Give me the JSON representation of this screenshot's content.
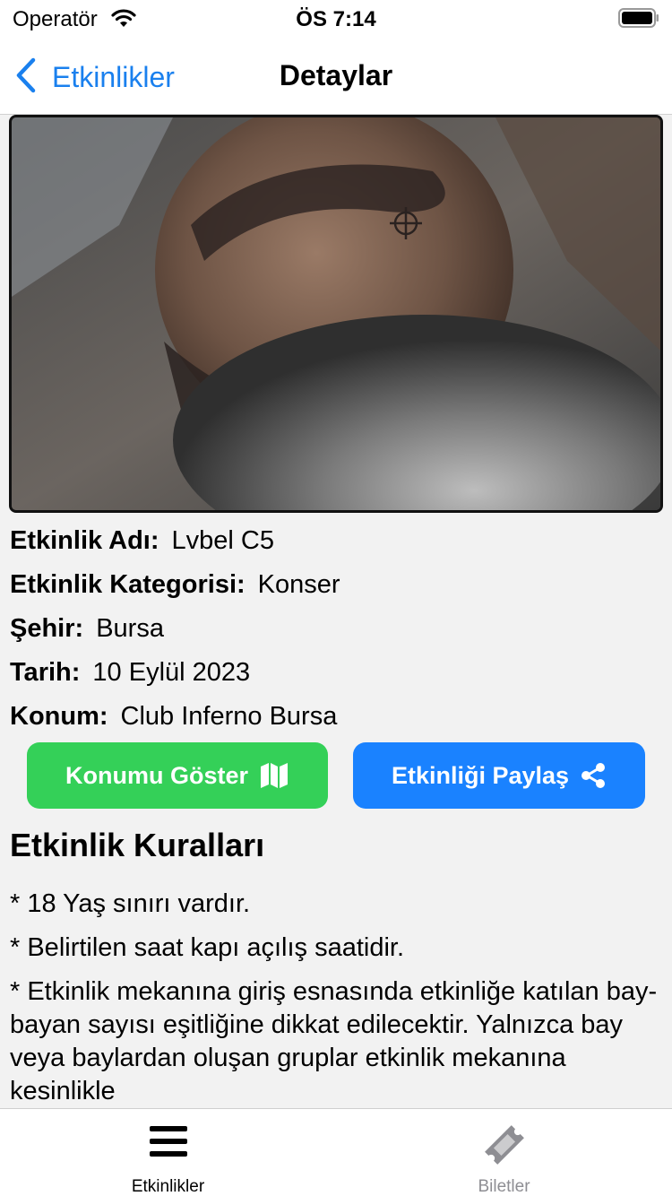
{
  "status_bar": {
    "carrier": "Operatör",
    "time": "ÖS 7:14"
  },
  "nav": {
    "back_label": "Etkinlikler",
    "title": "Detaylar"
  },
  "event": {
    "name_label": "Etkinlik Adı:",
    "name": "Lvbel C5",
    "category_label": "Etkinlik Kategorisi:",
    "category": "Konser",
    "city_label": "Şehir:",
    "city": "Bursa",
    "date_label": "Tarih:",
    "date": "10 Eylül 2023",
    "location_label": "Konum:",
    "location": "Club Inferno Bursa"
  },
  "actions": {
    "show_location": "Konumu Göster",
    "share_event": "Etkinliği Paylaş"
  },
  "rules": {
    "title": "Etkinlik Kuralları",
    "items": [
      "* 18 Yaş sınırı vardır.",
      "* Belirtilen saat kapı açılış saatidir.",
      "*  Etkinlik mekanına giriş esnasında etkinliğe katılan bay-bayan sayısı eşitliğine dikkat edilecektir. Yalnızca bay veya baylardan oluşan gruplar etkinlik mekanına kesinlikle"
    ]
  },
  "tabs": [
    {
      "label": "Etkinlikler",
      "icon": "list-icon",
      "active": true
    },
    {
      "label": "Biletler",
      "icon": "ticket-icon",
      "active": false
    }
  ],
  "colors": {
    "accent": "#1a80ee",
    "map_button": "#34d058",
    "share_button": "#1a82ff",
    "inactive_tab": "#8e8e93"
  }
}
